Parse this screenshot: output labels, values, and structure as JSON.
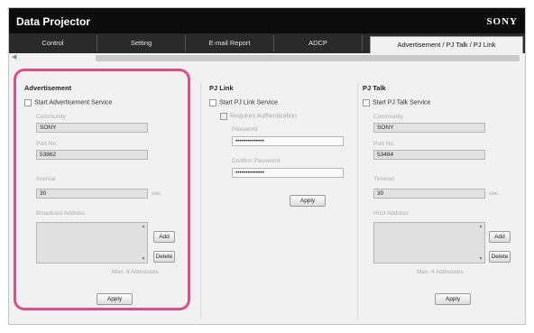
{
  "app": {
    "title": "Data Projector",
    "brand": "SONY"
  },
  "tabs": [
    {
      "label": "Control"
    },
    {
      "label": "Setting"
    },
    {
      "label": "E-mail Report"
    },
    {
      "label": "ADCP"
    },
    {
      "label": "Advertisement / PJ Talk / PJ Link",
      "active": true
    }
  ],
  "advertisement": {
    "title": "Advertisement",
    "start_label": "Start Advertisement Service",
    "community_label": "Community",
    "community_value": "SONY",
    "port_label": "Port No.",
    "port_value": "53862",
    "interval_label": "Interval",
    "interval_value": "30",
    "interval_unit": "sec.",
    "broadcast_label": "Broadcast Address",
    "add_label": "Add",
    "delete_label": "Delete",
    "max_note": "Max. 4 Addresses",
    "apply_label": "Apply"
  },
  "pjlink": {
    "title": "PJ Link",
    "start_label": "Start PJ Link Service",
    "requires_auth_label": "Requires Authentication",
    "password_label": "Password",
    "password_value": "••••••••••••••",
    "confirm_label": "Confirm Password",
    "confirm_value": "••••••••••••••",
    "apply_label": "Apply"
  },
  "pjtalk": {
    "title": "PJ Talk",
    "start_label": "Start PJ Talk Service",
    "community_label": "Community",
    "community_value": "SONY",
    "port_label": "Port No.",
    "port_value": "53484",
    "timeout_label": "Timeout",
    "timeout_value": "30",
    "timeout_unit": "sec.",
    "host_label": "Host Address",
    "add_label": "Add",
    "delete_label": "Delete",
    "max_note": "Max. 4 Addresses",
    "apply_label": "Apply"
  },
  "colors": {
    "highlight": "#d94f86",
    "titlebar": "#0c0c0c"
  },
  "icons": {
    "scroll_left": "chevron-left-icon",
    "scroll_up": "chevron-up-icon",
    "scroll_down": "chevron-down-icon"
  }
}
